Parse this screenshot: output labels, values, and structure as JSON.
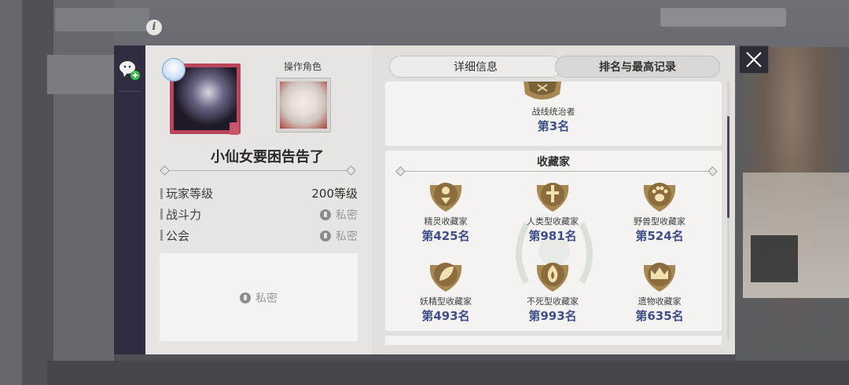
{
  "player": {
    "name": "小仙女要困告告了",
    "operate_character_label": "操作角色"
  },
  "stats": [
    {
      "label": "玩家等级",
      "value": "200等级",
      "private": false
    },
    {
      "label": "战斗力",
      "value": "私密",
      "private": true
    },
    {
      "label": "公会",
      "value": "私密",
      "private": true
    }
  ],
  "guild_box": {
    "private_label": "私密"
  },
  "tabs": {
    "details": "详细信息",
    "ranking": "排名与最高记录",
    "active": "ranking"
  },
  "top_record": {
    "name": "战线统治者",
    "rank": "第3名"
  },
  "collector_section": {
    "title": "收藏家",
    "badges": [
      {
        "name": "精灵收藏家",
        "rank": "第425名",
        "icon": "elf-emblem-icon"
      },
      {
        "name": "人类型收藏家",
        "rank": "第981名",
        "icon": "human-emblem-icon"
      },
      {
        "name": "野兽型收藏家",
        "rank": "第524名",
        "icon": "paw-emblem-icon"
      },
      {
        "name": "妖精型收藏家",
        "rank": "第493名",
        "icon": "leaf-emblem-icon"
      },
      {
        "name": "不死型收藏家",
        "rank": "第993名",
        "icon": "flame-emblem-icon"
      },
      {
        "name": "遗物收藏家",
        "rank": "第635名",
        "icon": "crown-emblem-icon"
      }
    ]
  },
  "colors": {
    "rank_text": "#3f4f88",
    "medal_gold": "#b08a4a",
    "side_strip": "#2f2d3f"
  }
}
